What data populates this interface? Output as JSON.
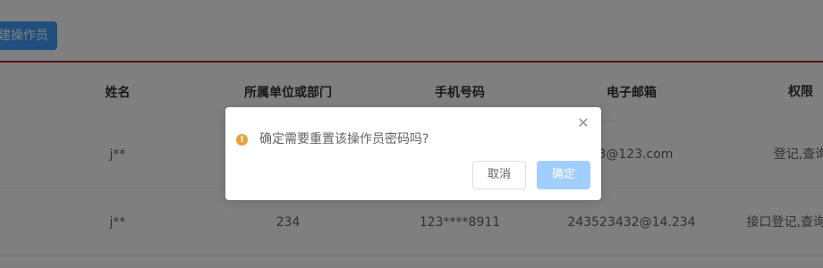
{
  "toolbar": {
    "create_label": "建操作员"
  },
  "table": {
    "headers": {
      "name": "姓名",
      "dept": "所属单位或部门",
      "phone": "手机号码",
      "email": "电子邮箱",
      "perm": "权限"
    },
    "rows": [
      {
        "name": "j**",
        "dept": "",
        "phone": "",
        "email": "23@123.com",
        "perm_line1": "登记,查询",
        "perm_line2": ""
      },
      {
        "name": "j**",
        "dept": "234",
        "phone": "123****8911",
        "email": "243523432@14.234",
        "perm_line1": "接口登记,查询,登",
        "perm_line2": "询"
      }
    ]
  },
  "dialog": {
    "message": "确定需要重置该操作员密码吗?",
    "cancel_label": "取消",
    "confirm_label": "确定",
    "close_glyph": "✕",
    "warning_glyph": "!"
  },
  "colors": {
    "primary": "#409eff",
    "primary_light": "#a0cfff",
    "warning": "#e6a23c",
    "table_top_border": "#b3222a"
  }
}
